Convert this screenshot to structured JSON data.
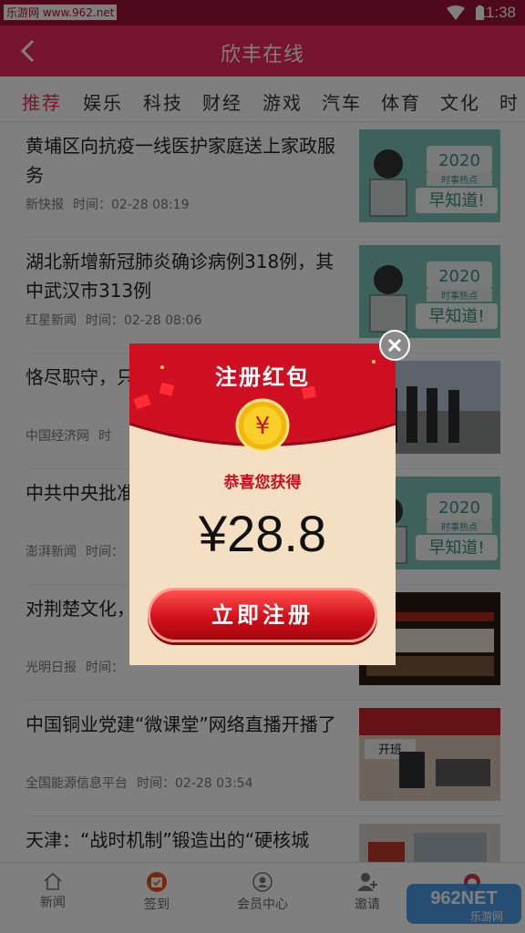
{
  "status_bar": {
    "watermark": "乐游网 www.962.net",
    "time": "11:38"
  },
  "app_bar": {
    "title": "欣丰在线"
  },
  "tabs": [
    {
      "label": "推荐",
      "active": true
    },
    {
      "label": "娱乐"
    },
    {
      "label": "科技"
    },
    {
      "label": "财经"
    },
    {
      "label": "游戏"
    },
    {
      "label": "汽车"
    },
    {
      "label": "体育"
    },
    {
      "label": "文化"
    },
    {
      "label": "时"
    }
  ],
  "news": [
    {
      "title": "黄埔区向抗疫一线医护家庭送上家政服务",
      "source": "新快报",
      "time": "时间：02-28 08:19",
      "thumb": "hot-news"
    },
    {
      "title": "湖北新增新冠肺炎确诊病例318例，其中武汉市313例",
      "source": "红星新闻",
      "time": "时间：02-28 08:06",
      "thumb": "hot-news"
    },
    {
      "title": "恪尽职守，只",
      "source": "中国经济网",
      "time": "时",
      "thumb": "photo-people"
    },
    {
      "title": "中共中央批准委副书记",
      "source": "澎湃新闻",
      "time": "时间：",
      "thumb": "hot-news"
    },
    {
      "title": "对荆楚文化，",
      "source": "光明日报",
      "time": "时间：",
      "thumb": "photo-exhibit"
    },
    {
      "title": "中国铜业党建“微课堂”网络直播开播了",
      "source": "全国能源信息平台",
      "time": "时间：02-28 03:54",
      "thumb": "photo-class"
    },
    {
      "title": "天津：“战时机制”锻造出的“硬核城",
      "source": "",
      "time": "",
      "thumb": "photo-city"
    }
  ],
  "hot_thumb": {
    "year": "2020",
    "sub": "时事热点",
    "slogan": "早知道!"
  },
  "class_thumb": {
    "banner": "开班"
  },
  "tab_bar": [
    {
      "label": "新闻",
      "icon": "home-icon"
    },
    {
      "label": "签到",
      "icon": "calendar-check-icon"
    },
    {
      "label": "会员中心",
      "icon": "user-circle-icon"
    },
    {
      "label": "邀请",
      "icon": "user-add-icon"
    },
    {
      "label": "",
      "icon": "mascot-icon"
    }
  ],
  "brand_watermark": {
    "logo": "962NET",
    "site": "乐游网"
  },
  "popup": {
    "title": "注册红包",
    "coin_symbol": "¥",
    "congrats": "恭喜您获得",
    "amount": "¥28.8",
    "button": "立即注册"
  },
  "colors": {
    "brand": "#ee2a5f",
    "status_bar": "#9e1138",
    "popup_red": "#c8101f",
    "popup_bg": "#f4dfc3"
  }
}
